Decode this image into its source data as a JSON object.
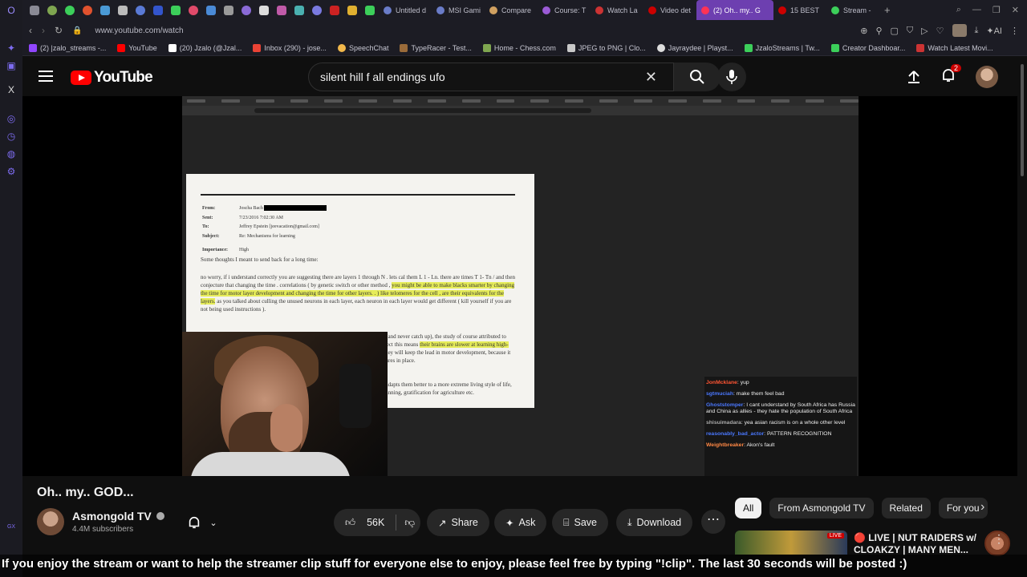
{
  "browser": {
    "tabs": [
      {
        "label": "Untitled d",
        "color": "#6a7cc8"
      },
      {
        "label": "MSI Gami",
        "color": "#6a7cc8"
      },
      {
        "label": "Compare",
        "color": "#d0a060"
      },
      {
        "label": "Course: T",
        "color": "#9b5bd6"
      },
      {
        "label": "Watch La",
        "color": "#cc3333"
      },
      {
        "label": "Video det",
        "color": "#cc0000"
      },
      {
        "label": "(2) Oh.. my.. G",
        "color": "#ff3355"
      },
      {
        "label": "15 BEST",
        "color": "#cc0000"
      },
      {
        "label": "Stream -",
        "color": "#3ccf5a"
      }
    ],
    "url": "www.youtube.com/watch",
    "address_tools": {
      "ai_label": "AI"
    },
    "bookmarks": [
      {
        "label": "(2) |zalo_streams -...",
        "color": "#9146ff"
      },
      {
        "label": "YouTube",
        "color": "#ff0000"
      },
      {
        "label": "(20) Jzalo (@Jzal...",
        "color": "#ffffff"
      },
      {
        "label": "Inbox (290) - jose...",
        "color": "#ea4335"
      },
      {
        "label": "SpeechChat",
        "color": "#f2b84b"
      },
      {
        "label": "TypeRacer - Test...",
        "color": "#9a6b3a"
      },
      {
        "label": "Home - Chess.com",
        "color": "#7fa650"
      },
      {
        "label": "JPEG to PNG | Clo...",
        "color": "#c8c8c8"
      },
      {
        "label": "Jayraydee | Playst...",
        "color": "#dddddd"
      },
      {
        "label": "JzaloStreams | Tw...",
        "color": "#3ccf5a"
      },
      {
        "label": "Creator Dashboar...",
        "color": "#3ccf5a"
      },
      {
        "label": "Watch Latest Movi...",
        "color": "#cc3333"
      }
    ]
  },
  "youtube": {
    "logo_text": "YouTube",
    "search_value": "silent hill f all endings ufo",
    "notification_count": "2"
  },
  "video_content": {
    "document": {
      "from_label": "From:",
      "from_value": "Joscha Bach",
      "sent_label": "Sent:",
      "sent_value": "7/23/2016 7:02:30 AM",
      "to_label": "To:",
      "to_value": "Jeffrey Epstein [jeevacation@gmail.com]",
      "subject_label": "Subject:",
      "subject_value": "Re: Mechanisms for learning",
      "importance_label": "Importance:",
      "importance_value": "High",
      "intro": "Some thoughts I meant to send back for a long time:",
      "para1_a": "no worry,       if i understand correctly  you are suggesting  there are layers  1  through N .  lets cal them L 1 - Ln.   there are times T 1- Tn /     and then conjecture  that changing the time . correlations  ( by genetic switch or other method  , ",
      "para1_hl1": "you might be able to make blacks smarter by changing the time for motor layer development  and changing the time for other layers. .  )      like telomeres for the cell , are their equivalents for the layers.",
      "para1_b": "   as you talked about culling the unused neurons in each layer,  each neuron in each layer would get different  ( kill yourself if you are not being used instructions ).",
      "para2_a": "I looked up the statistics, black kids in the US have slower cognitive development (and never catch up), the study of course attributed to social factors without any evidence, and they had faster motor development. I suspect this means ",
      "para2_hl": "their brains are slower at learning high-level concepts",
      "para2_b": ", because the low-level layers are optimized for a shorter time. But they will keep the lead in motor development, because it is theirs, and they have more time and attention to practice once they get the structures in place.",
      "para3": "It could also be that they have an additional set of learning directives in place that adapts them better to a more extreme living style of life, whereas the Europeans had to adapt for identifying long-term seasonal patterns, planning, gratification for agriculture etc."
    },
    "chat": [
      {
        "user": "JonMcklane",
        "color": "#ff5533",
        "msg": "yup"
      },
      {
        "user": "sgtmuciah",
        "color": "#4a78ff",
        "msg": "make them feel bad"
      },
      {
        "user": "Ghoststomper",
        "color": "#4a78ff",
        "msg": "I cant understand by South Africa has Russia and China as allies - they hate the population of South Africa"
      },
      {
        "user": "shisuimadara",
        "color": "#aaaaaa",
        "msg": "yea asian racism is on a whole other level"
      },
      {
        "user": "reasonably_bad_actor",
        "color": "#4a78ff",
        "msg": "PATTERN RECOGNITION"
      },
      {
        "user": "Weightbreaker",
        "color": "#ff8844",
        "msg": "Akon's fault"
      }
    ]
  },
  "video": {
    "title": "Oh.. my.. GOD...",
    "channel_name": "Asmongold TV",
    "subscribers": "4.4M subscribers",
    "likes": "56K",
    "share_label": "Share",
    "ask_label": "Ask",
    "save_label": "Save",
    "download_label": "Download"
  },
  "chips": [
    "All",
    "From Asmongold TV",
    "Related",
    "For you"
  ],
  "recommendation": {
    "live_badge": "LIVE",
    "title": "🔴 LIVE | NUT RAIDERS w/ CLOAKZY | MANY MEN..."
  },
  "ticker": "If you enjoy the stream or want to help the streamer clip stuff for everyone else to enjoy, please feel free by typing \"!clip\". The last 30 seconds will be posted :)"
}
